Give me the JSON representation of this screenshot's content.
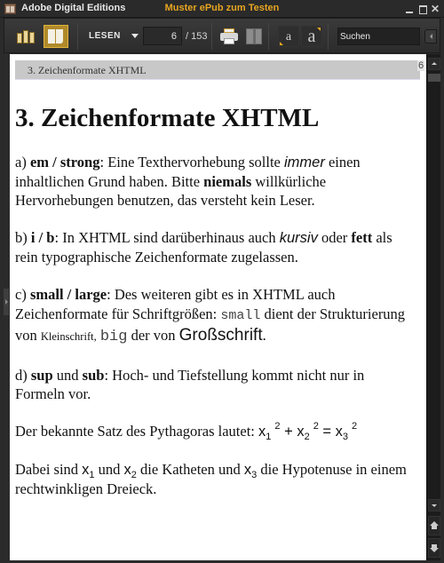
{
  "window": {
    "app_title": "Adobe Digital Editions",
    "document_title": "Muster ePub zum Testen",
    "controls": {
      "minimize": "minimize",
      "maximize": "maximize",
      "close": "✕"
    }
  },
  "toolbar": {
    "library_icon": "library-icon",
    "reading_view_icon": "reading-view-icon",
    "view_mode_label": "LESEN",
    "current_page": "6",
    "page_total": "/ 153",
    "print_icon": "print-icon",
    "bookmark_icon": "bookmark-icon",
    "font_smaller_label": "a",
    "font_larger_label": "a",
    "search_value": "Suchen",
    "accent_color": "#e6a521"
  },
  "page": {
    "running_head": "3. Zeichenformate XHTML",
    "page_number": "6",
    "heading": "3. Zeichenformate XHTML",
    "para_a": {
      "prefix": "a) ",
      "bold1": "em / strong",
      "text1": ": Eine Texthervorhebung sollte ",
      "italic1": "immer",
      "text2": " einen inhaltlichen Grund haben. Bitte ",
      "bold2": "niemals",
      "text3": " willkürliche Hervorhebungen benutzen, das versteht kein Leser."
    },
    "para_b": {
      "prefix": "b) ",
      "bold1": "i / b",
      "text1": ": In XHTML sind darüberhinaus auch ",
      "italic1": "kursiv",
      "text2": " oder ",
      "bold2": "fett",
      "text3": " als rein typographische Zeichenformate zugelassen."
    },
    "para_c": {
      "prefix": "c) ",
      "bold1": "small / large",
      "text1": ": Des weiteren gibt es in XHTML auch Zeichenformate für Schriftgrößen: ",
      "code1": "small",
      "text2": " dient der Strukturierung von ",
      "small_text": "Kleinschrift,",
      "text3": " ",
      "code2": "big",
      "text4": " der von ",
      "big_text": "Großschrift",
      "text5": "."
    },
    "para_d": {
      "prefix": "d) ",
      "bold1": "sup",
      "text1": " und ",
      "bold2": "sub",
      "text2": ": Hoch- und Tiefstellung kommt nicht nur in Formeln vor."
    },
    "para_pythagoras": {
      "text": "Der bekannte Satz des Pythagoras lautet: ",
      "var": "x",
      "sub1": "1",
      "sub2": "2",
      "sub3": "3",
      "exp": "2",
      "plus": " + ",
      "equals": " = "
    },
    "para_katheten": {
      "text1": "Dabei sind ",
      "var": "x",
      "sub1": "1",
      "text2": " und ",
      "sub2": "2",
      "text3": " die Katheten und ",
      "sub3": "3",
      "text4": " die Hypotenuse in einem rechtwinkligen Dreieck."
    }
  }
}
